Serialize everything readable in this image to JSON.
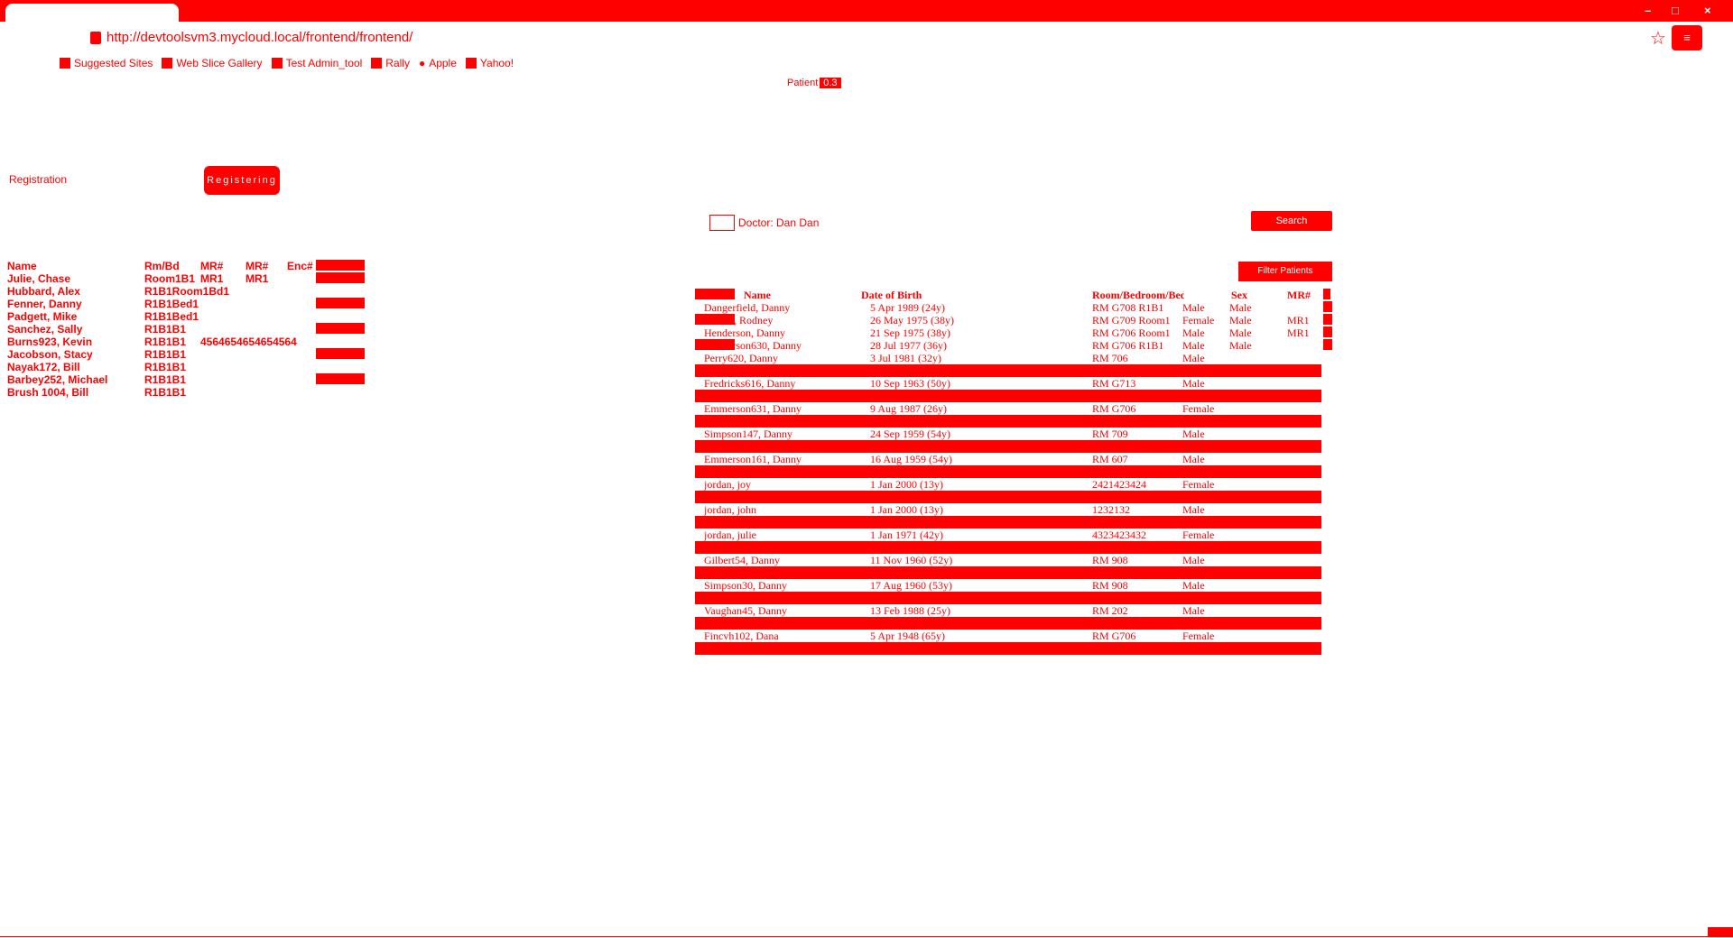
{
  "browser": {
    "url": "http://devtoolsvm3.mycloud.local/frontend/frontend/",
    "controls": {
      "minimize": "–",
      "maximize": "□",
      "close": "×"
    },
    "menu_label": "≡",
    "bookmarks": [
      {
        "label": "Suggested Sites",
        "icon": "puzzle-icon"
      },
      {
        "label": "Web Slice Gallery",
        "icon": "bookmark-icon"
      },
      {
        "label": "Test Admin_tool",
        "icon": "page-icon"
      },
      {
        "label": "Rally",
        "icon": "page-icon"
      },
      {
        "label": "Apple",
        "icon": "apple-icon"
      },
      {
        "label": "Yahoo!",
        "icon": "page-icon"
      }
    ],
    "center_badge": {
      "text": "Patient",
      "count": "0.3"
    }
  },
  "registration": {
    "label": "Registration",
    "button": "Registering"
  },
  "left_table": {
    "headers": {
      "name": "Name",
      "rm": "Rm/Bd",
      "mr": "MR#",
      "mr2": "MR#",
      "enc": "Enc#"
    },
    "rows": [
      {
        "name": "Julie, Chase",
        "rm": "Room1B1",
        "mr": "MR1",
        "mr2": "MR1",
        "enc": ""
      },
      {
        "name": "Hubbard, Alex",
        "rm": "R1B1Room1Bd1",
        "mr": "",
        "mr2": "",
        "enc": ""
      },
      {
        "name": "Fenner, Danny",
        "rm": "R1B1Bed1",
        "mr": "",
        "mr2": "",
        "enc": ""
      },
      {
        "name": "Padgett, Mike",
        "rm": "R1B1Bed1",
        "mr": "",
        "mr2": "",
        "enc": ""
      },
      {
        "name": "Sanchez, Sally",
        "rm": "R1B1B1",
        "mr": "",
        "mr2": "",
        "enc": ""
      },
      {
        "name": "Burns923, Kevin",
        "rm": "R1B1B1",
        "mr": "4564654654654564",
        "mr2": "",
        "enc": ""
      },
      {
        "name": "Jacobson, Stacy",
        "rm": "R1B1B1",
        "mr": "",
        "mr2": "",
        "enc": ""
      },
      {
        "name": "Nayak172, Bill",
        "rm": "R1B1B1",
        "mr": "",
        "mr2": "",
        "enc": ""
      },
      {
        "name": "Barbey252, Michael",
        "rm": "R1B1B1",
        "mr": "",
        "mr2": "",
        "enc": ""
      },
      {
        "name": "Brush 1004, Bill",
        "rm": "R1B1B1",
        "mr": "",
        "mr2": "",
        "enc": ""
      }
    ]
  },
  "doctor": {
    "label": "Doctor: Dan Dan",
    "right_button": "Search"
  },
  "filter_button": "Filter Patients",
  "patient_table": {
    "headers": {
      "name": "Name",
      "dob": "Date of Birth",
      "room": "Room/Bedroom/Bed",
      "sex": "Sex",
      "sex2": "MR#",
      "mr": "MR#"
    },
    "rows": [
      {
        "name": "Dangerfield, Danny",
        "dob": "5 Apr 1989 (24y)",
        "room": "RM G708 R1B1",
        "sex": "Male",
        "sex2": "Male",
        "mr": ""
      },
      {
        "name": "Waters, Rodney",
        "dob": "26 May 1975 (38y)",
        "room": "RM G709 Room1",
        "sex": "Female",
        "sex2": "Male",
        "mr": "MR1"
      },
      {
        "name": "Henderson, Danny",
        "dob": "21 Sep 1975 (38y)",
        "room": "RM G706 Room1",
        "sex": "Male",
        "sex2": "Male",
        "mr": "MR1"
      },
      {
        "name": "Emmerson630, Danny",
        "dob": "28 Jul 1977 (36y)",
        "room": "RM G706 R1B1",
        "sex": "Male",
        "sex2": "Male",
        "mr": ""
      },
      {
        "name": "Perry620, Danny",
        "dob": "3 Jul 1981 (32y)",
        "room": "RM 706",
        "sex": "Male",
        "sex2": "",
        "mr": ""
      },
      {
        "name": "Fredricks616, Danny",
        "dob": "10 Sep 1963 (50y)",
        "room": "RM G713",
        "sex": "Male",
        "sex2": "",
        "mr": ""
      },
      {
        "name": "Emmerson631, Danny",
        "dob": "9 Aug 1987 (26y)",
        "room": "RM G706",
        "sex": "Female",
        "sex2": "",
        "mr": ""
      },
      {
        "name": "Simpson147, Danny",
        "dob": "24 Sep 1959 (54y)",
        "room": "RM 709",
        "sex": "Male",
        "sex2": "",
        "mr": ""
      },
      {
        "name": "Emmerson161, Danny",
        "dob": "16 Aug 1959 (54y)",
        "room": "RM 607",
        "sex": "Male",
        "sex2": "",
        "mr": ""
      },
      {
        "name": "jordan, joy",
        "dob": "1 Jan 2000 (13y)",
        "room": "2421423424",
        "sex": "Female",
        "sex2": "",
        "mr": ""
      },
      {
        "name": "jordan, john",
        "dob": "1 Jan 2000 (13y)",
        "room": "1232132",
        "sex": "Male",
        "sex2": "",
        "mr": ""
      },
      {
        "name": "jordan, julie",
        "dob": "1 Jan 1971 (42y)",
        "room": "4323423432",
        "sex": "Female",
        "sex2": "",
        "mr": ""
      },
      {
        "name": "Gilbert54, Danny",
        "dob": "11 Nov 1960 (52y)",
        "room": "RM 908",
        "sex": "Male",
        "sex2": "",
        "mr": ""
      },
      {
        "name": "Simpson30, Danny",
        "dob": "17 Aug 1960 (53y)",
        "room": "RM 908",
        "sex": "Male",
        "sex2": "",
        "mr": ""
      },
      {
        "name": "Vaughan45, Danny",
        "dob": "13 Feb 1988 (25y)",
        "room": "RM 202",
        "sex": "Male",
        "sex2": "",
        "mr": ""
      },
      {
        "name": "Fincvh102, Dana",
        "dob": "5 Apr 1948 (65y)",
        "room": "RM G706",
        "sex": "Female",
        "sex2": "",
        "mr": ""
      }
    ]
  },
  "colors": {
    "accent": "#ff0000",
    "background": "#ffffff"
  }
}
